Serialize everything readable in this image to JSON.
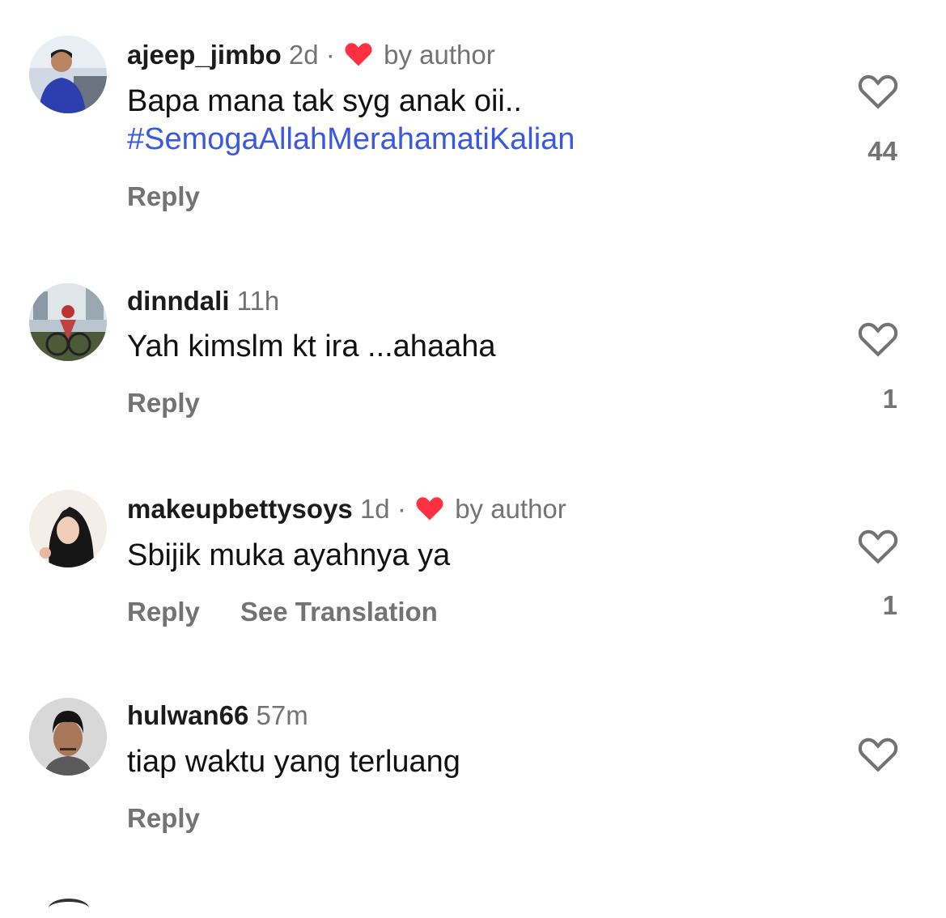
{
  "colors": {
    "heart_red": "#ff3040",
    "hashtag_blue": "#3a58e0",
    "muted_gray": "#737373"
  },
  "comments": [
    {
      "username": "ajeep_jimbo",
      "time": "2d",
      "liked_by_author": true,
      "separator": "·",
      "by_author": "by author",
      "text_line1": "Bapa mana tak syg anak oii..",
      "text_line2": "#SemogaAllahMerahamatiKalian",
      "reply": "Reply",
      "likes": "44",
      "like_icon": "heart-outline-icon"
    },
    {
      "username": "dinndali",
      "time": "11h",
      "liked_by_author": false,
      "text_line1": "Yah kimslm kt ira ...ahaaha",
      "reply": "Reply",
      "likes": "1",
      "like_icon": "heart-outline-icon"
    },
    {
      "username": "makeupbettysoys",
      "time": "1d",
      "liked_by_author": true,
      "separator": "·",
      "by_author": "by author",
      "text_line1": "Sbijik muka ayahnya ya",
      "reply": "Reply",
      "see_translation": "See Translation",
      "likes": "1",
      "like_icon": "heart-outline-icon"
    },
    {
      "username": "hulwan66",
      "time": "57m",
      "liked_by_author": false,
      "text_line1": "tiap waktu yang terluang",
      "reply": "Reply",
      "likes": "",
      "like_icon": "heart-outline-icon"
    }
  ]
}
